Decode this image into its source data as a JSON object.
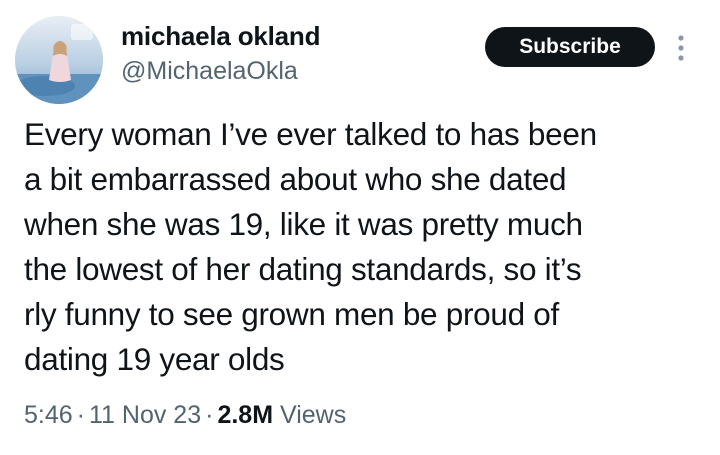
{
  "author": {
    "name": "michaela okland",
    "handle": "@MichaelaOkla"
  },
  "actions": {
    "subscribe_label": "Subscribe"
  },
  "tweet": {
    "lines": [
      "Every woman I’ve ever talked to has been",
      "a bit embarrassed about who she dated",
      "when she was 19, like it was pretty much",
      "the lowest of her dating standards, so it’s",
      "rly funny to see grown men be proud of",
      "dating 19 year olds"
    ]
  },
  "meta": {
    "time": "5:46",
    "separator": "·",
    "date": "11 Nov 23",
    "views_count": "2.8M",
    "views_label": "Views"
  },
  "colors": {
    "text": "#0f1419",
    "secondary_text": "#536471",
    "button_bg": "#0f1419",
    "button_text": "#ffffff"
  },
  "icons": {
    "more": "more-vertical-icon"
  }
}
